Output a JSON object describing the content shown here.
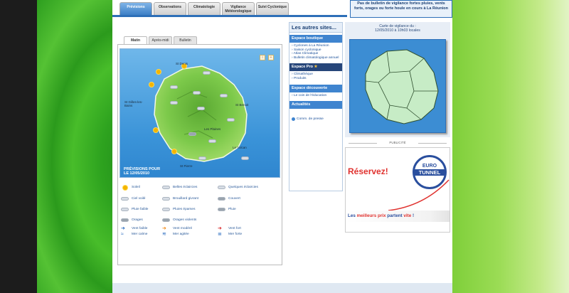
{
  "tabs": [
    {
      "label": "Prévisions"
    },
    {
      "label": "Observations"
    },
    {
      "label": "Climatologie"
    },
    {
      "label": "Vigilance Météorologique"
    },
    {
      "label": "Suivi Cyclonique"
    }
  ],
  "vigilance": {
    "banner": "Pas de bulletin de vigilance fortes pluies, vents forts, orages ou forte houle en cours à La Réunion",
    "caption_line1": "Carte de vigilance du :",
    "caption_line2": "12/05/2010 à 10h03 locales"
  },
  "forecast": {
    "tabs": [
      {
        "label": "Matin"
      },
      {
        "label": "Après-midi"
      },
      {
        "label": "Bulletin"
      }
    ],
    "date_line1": "PRÉVISIONS POUR",
    "date_line2": "LE 12/05/2010",
    "towns": {
      "st_denis": "St Denis",
      "st_gilles": "St Gilles-les-Bains",
      "st_benoit": "St Benoit",
      "les_plaines": "Les Plaines",
      "le_volcan": "Le Volcan",
      "st_pierre": "St Pierre"
    },
    "legend": {
      "soleil": "Soleil",
      "belles_eclaircies": "Belles éclaircies",
      "quelques_eclaircies": "Quelques éclaircies",
      "ciel_voile": "Ciel voilé",
      "brouillard": "Brouillard givrant",
      "couvert": "Couvert",
      "pluie_faible": "Pluie faible",
      "pluies_eparses": "Pluies éparses",
      "pluie": "Pluie",
      "orages": "Orages",
      "orages_violents": "Orages violents",
      "vent_faible": "Vent faible",
      "vent_modere": "Vent modéré",
      "vent_fort": "Vent fort",
      "mer_calme": "Mer calme",
      "mer_agitee": "Mer agitée",
      "mer_forte": "Mer forte"
    }
  },
  "sites": {
    "title": "Les autres sites...",
    "boutique": {
      "title": "Espace boutique",
      "items": [
        "Cyclones à La Réunion",
        "Saison cyclonique",
        "Atlas Climatique",
        "Bulletin climatologique annuel"
      ]
    },
    "pro": {
      "title": "Espace Pro",
      "items": [
        "Climathèque",
        "Produits"
      ]
    },
    "decouverte": {
      "title": "Espace découverte",
      "items": [
        "Le coin de l'éducation"
      ]
    },
    "actualites": {
      "title": "Actualités",
      "comm": "Comm. de presse"
    }
  },
  "pub": {
    "label": "PUBLICITÉ",
    "reservez": "Réservez!",
    "logo_line1": "EURO",
    "logo_line2": "TUNNEL",
    "slogan_a": "Les ",
    "slogan_b": "meilleurs prix",
    "slogan_c": " partent ",
    "slogan_d": "vite",
    "slogan_e": " !"
  },
  "colors": {
    "accent": "#2d6fb8",
    "island": "#7cc94a",
    "sea": "#3a93d8",
    "vigilance_green": "#c7ecc6"
  }
}
